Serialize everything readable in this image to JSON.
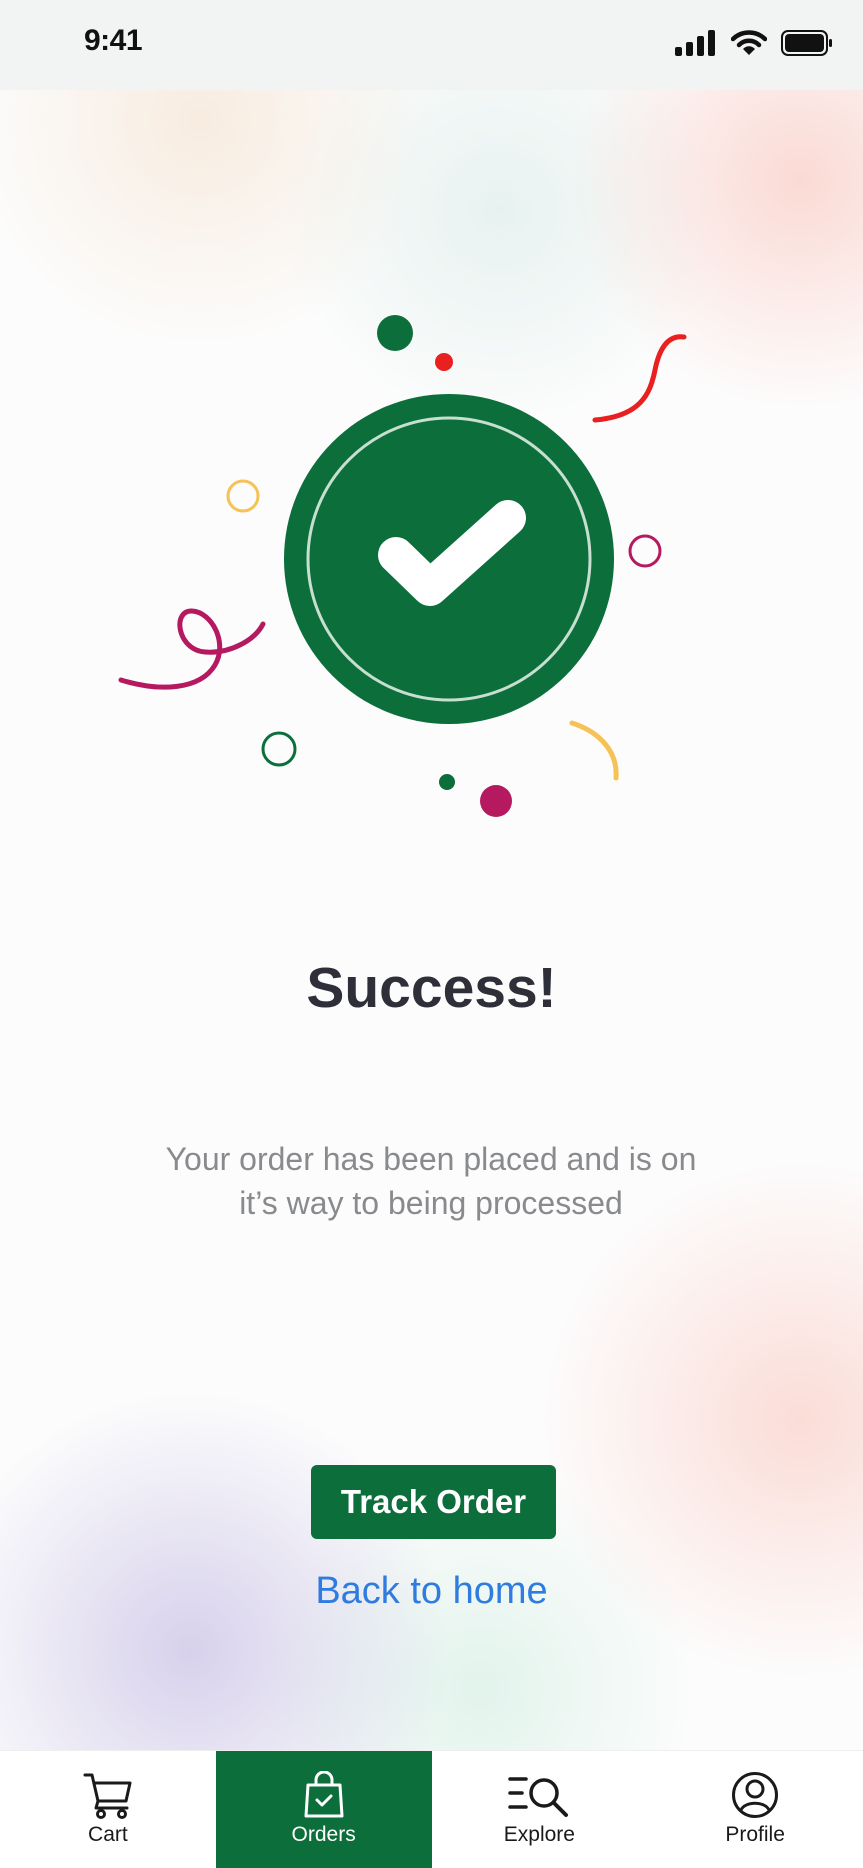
{
  "status_bar": {
    "time": "9:41"
  },
  "success": {
    "title": "Success!",
    "message_line1": "Your order has been placed and is on",
    "message_line2": "it’s way to being processed"
  },
  "actions": {
    "track_label": "Track Order",
    "home_label": "Back to home"
  },
  "tabs": [
    {
      "label": "Cart",
      "icon": "cart-icon",
      "active": false
    },
    {
      "label": "Orders",
      "icon": "shopping-bag-check-icon",
      "active": true
    },
    {
      "label": "Explore",
      "icon": "explore-search-icon",
      "active": false
    },
    {
      "label": "Profile",
      "icon": "profile-icon",
      "active": false
    }
  ],
  "colors": {
    "primary": "#0b6e3b",
    "link": "#2f7ce0",
    "title": "#2e2f38",
    "muted": "#888a8e",
    "confetti_red": "#e8201f",
    "confetti_magenta": "#b5195f",
    "confetti_yellow": "#f5c255"
  }
}
